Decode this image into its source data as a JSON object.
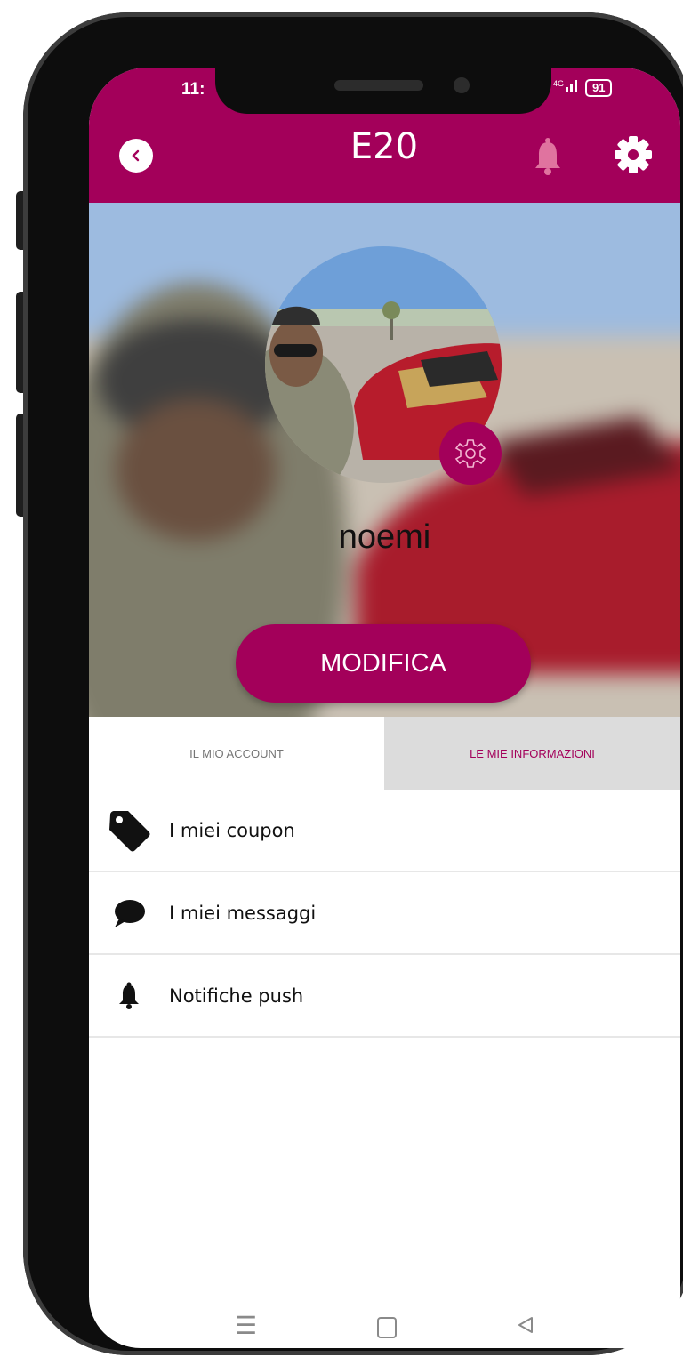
{
  "status_bar": {
    "time": "11:",
    "network": "4G",
    "battery": "91"
  },
  "header": {
    "title": "E20",
    "back_icon": "chevron-left-icon",
    "bell_icon": "bell-icon",
    "settings_icon": "gear-icon"
  },
  "profile": {
    "name": "noemi",
    "edit_label": "MODIFICA",
    "avatar_settings_icon": "gear-outline-icon"
  },
  "tabs": [
    {
      "label": "IL MIO ACCOUNT",
      "active": false
    },
    {
      "label": "LE MIE INFORMAZIONI",
      "active": true
    }
  ],
  "menu": [
    {
      "label": "I miei coupon",
      "icon": "tag-icon"
    },
    {
      "label": "I miei messaggi",
      "icon": "speech-bubble-icon"
    },
    {
      "label": "Notifiche push",
      "icon": "bell-icon"
    }
  ],
  "nav": {
    "menu_icon": "menu-icon",
    "home_icon": "home-icon",
    "back_icon": "back-triangle-icon"
  },
  "colors": {
    "accent": "#a3005a",
    "tab_inactive_bg": "#dcdcdc",
    "frame": "#0d0d0d"
  }
}
